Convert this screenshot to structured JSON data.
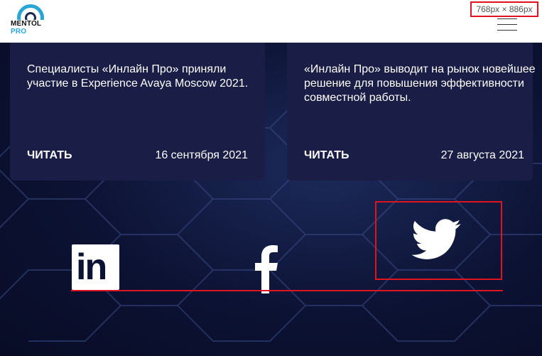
{
  "header": {
    "logo": {
      "word": "MENTOL",
      "suffix": "PRO",
      "icon": "logo-ring-icon"
    },
    "size_badge": "768px × 886px",
    "menu_icon": "hamburger-menu-icon"
  },
  "news": [
    {
      "text": "Специалисты «Инлайн Про» приняли участие в Experience Avaya Moscow 2021.",
      "read_label": "ЧИТАТЬ",
      "date": "16 сентября 2021"
    },
    {
      "text": "«Инлайн Про» выводит на рынок новейшее решение для повышения эффективности совместной работы.",
      "read_label": "ЧИТАТЬ",
      "date": "27 августа 2021"
    }
  ],
  "social": {
    "linkedin": {
      "icon": "linkedin-icon",
      "label": "in"
    },
    "facebook": {
      "icon": "facebook-icon"
    },
    "twitter": {
      "icon": "twitter-icon"
    }
  },
  "colors": {
    "background": "#0c1233",
    "card": "#1a1d45",
    "accent_red": "#e0141e",
    "logo_blue": "#2aa6d6"
  }
}
